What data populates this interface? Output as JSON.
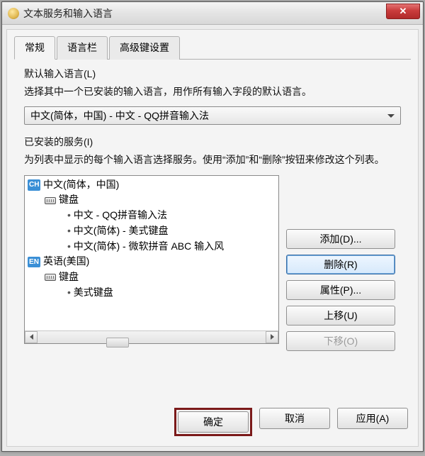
{
  "window": {
    "title": "文本服务和输入语言"
  },
  "tabs": {
    "general": "常规",
    "langbar": "语言栏",
    "advanced": "高级键设置"
  },
  "default_lang": {
    "title": "默认输入语言(L)",
    "desc": "选择其中一个已安装的输入语言，用作所有输入字段的默认语言。",
    "selected": "中文(简体，中国) - 中文 - QQ拼音输入法"
  },
  "services": {
    "title": "已安装的服务(I)",
    "desc": "为列表中显示的每个输入语言选择服务。使用“添加”和“删除”按钮来修改这个列表。",
    "tree": {
      "ch_badge": "CH",
      "ch_label": "中文(简体，中国)",
      "kb_label": "键盘",
      "ch_items": [
        "中文 - QQ拼音输入法",
        "中文(简体) - 美式键盘",
        "中文(简体) - 微软拼音 ABC 输入风"
      ],
      "en_badge": "EN",
      "en_label": "英语(美国)",
      "en_items": [
        "美式键盘"
      ]
    },
    "buttons": {
      "add": "添加(D)...",
      "remove": "删除(R)",
      "properties": "属性(P)...",
      "moveup": "上移(U)",
      "movedown": "下移(O)"
    }
  },
  "footer": {
    "ok": "确定",
    "cancel": "取消",
    "apply": "应用(A)"
  }
}
